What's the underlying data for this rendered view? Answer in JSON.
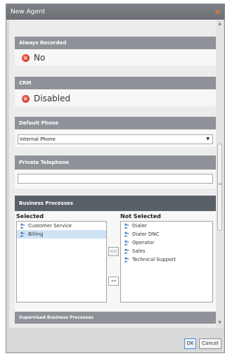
{
  "window": {
    "title": "New Agent",
    "close_glyph": "×"
  },
  "sections": {
    "always_recorded": {
      "header": "Always Recorded",
      "value": "No",
      "icon": "x-circle-icon"
    },
    "crm": {
      "header": "CRM",
      "value": "Disabled",
      "icon": "x-circle-icon"
    },
    "default_phone": {
      "header": "Default Phone",
      "value": "Internal Phone"
    },
    "private_telephone": {
      "header": "Private Telephone",
      "value": ""
    },
    "business_processes": {
      "header": "Business Processes",
      "selected_label": "Selected",
      "not_selected_label": "Not Selected",
      "selected_items": [
        "Customer Service",
        "Billing"
      ],
      "selected_highlight": "Billing",
      "not_selected_items": [
        "Dialer",
        "Dialer DNC",
        "Operator",
        "Sales",
        "Technical Support"
      ],
      "move_left": "<<",
      "move_right": "»»"
    },
    "supervised_business_processes": {
      "header": "Supervised Business Processes"
    }
  },
  "buttons": {
    "ok": "OK",
    "cancel": "Cancel"
  },
  "colors": {
    "header_bg": "#8f9399",
    "dark_header_bg": "#5a6068",
    "status_red": "#d23a26",
    "accent_blue": "#4a90d9"
  }
}
